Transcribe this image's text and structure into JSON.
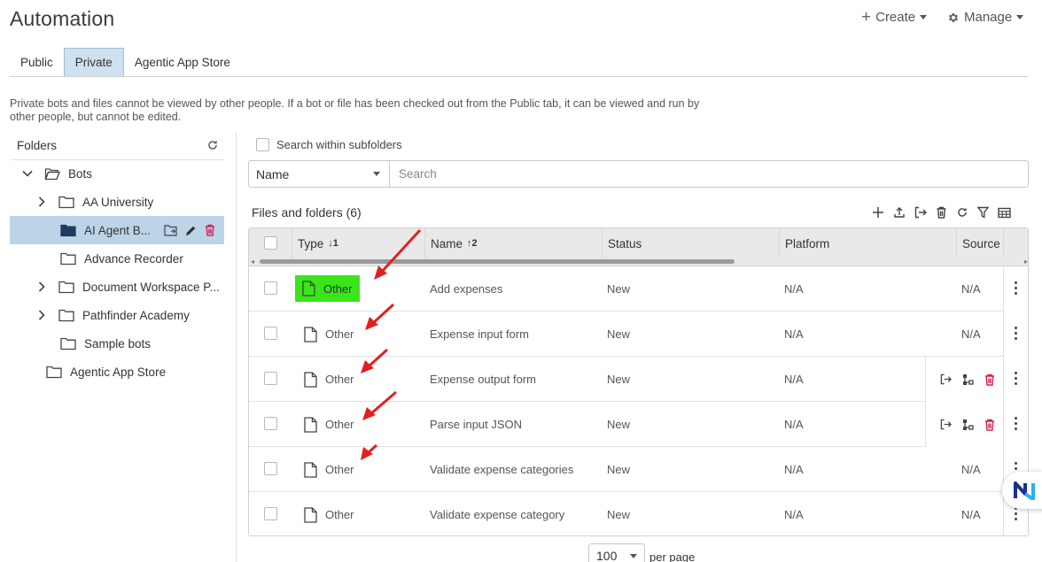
{
  "header": {
    "title": "Automation",
    "create_label": "Create",
    "manage_label": "Manage"
  },
  "tabs": [
    {
      "label": "Public",
      "active": false
    },
    {
      "label": "Private",
      "active": true
    },
    {
      "label": "Agentic App Store",
      "active": false
    }
  ],
  "description": "Private bots and files cannot be viewed by other people. If a bot or file has been checked out from the Public tab, it can be viewed and run by other people, but cannot be edited.",
  "folders": {
    "header": "Folders",
    "tree": [
      {
        "label": "Bots",
        "expanded": true
      },
      {
        "label": "AA University",
        "expanded": false
      },
      {
        "label": "AI Agent B...",
        "selected": true
      },
      {
        "label": "Advance Recorder"
      },
      {
        "label": "Document Workspace P..."
      },
      {
        "label": "Pathfinder Academy"
      },
      {
        "label": "Sample bots"
      },
      {
        "label": "Agentic App Store"
      }
    ]
  },
  "search": {
    "subfolders_label": "Search within subfolders",
    "field_select": "Name",
    "placeholder": "Search"
  },
  "files": {
    "title": "Files and folders (6)",
    "columns": {
      "type": "Type",
      "type_sort": "↓1",
      "name": "Name",
      "name_sort": "↑2",
      "status": "Status",
      "platform": "Platform",
      "source": "Source"
    },
    "rows": [
      {
        "type": "Other",
        "name": "Add expenses",
        "status": "New",
        "platform": "N/A",
        "source": "N/A",
        "highlighted": true
      },
      {
        "type": "Other",
        "name": "Expense input form",
        "status": "New",
        "platform": "N/A",
        "source": "N/A"
      },
      {
        "type": "Other",
        "name": "Expense output form",
        "status": "New",
        "platform": "N/A",
        "source": "",
        "hover_actions": true
      },
      {
        "type": "Other",
        "name": "Parse input JSON",
        "status": "New",
        "platform": "N/A",
        "source": "",
        "hover_actions": true
      },
      {
        "type": "Other",
        "name": "Validate expense categories",
        "status": "New",
        "platform": "N/A",
        "source": "N/A"
      },
      {
        "type": "Other",
        "name": "Validate expense category",
        "status": "New",
        "platform": "N/A",
        "source": "N/A"
      }
    ]
  },
  "pagination": {
    "page_size": "100",
    "per_page_label": "per page"
  },
  "colors": {
    "accent_tab": "#cfe0ef",
    "highlight": "#39e619",
    "annotation_arrow": "#e02020",
    "delete_red": "#d0224d"
  }
}
